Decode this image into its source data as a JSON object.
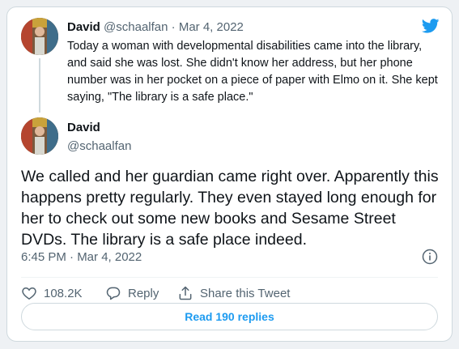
{
  "quoted_tweet": {
    "name": "David",
    "handle": "@schaalfan",
    "separator": "·",
    "date": "Mar 4, 2022",
    "text": "Today a woman with developmental disabilities came into the library, and said she was lost. She didn't know her address, but her phone number was in her pocket on a piece of paper with Elmo on it. She kept saying, \"The library is a safe place.\""
  },
  "main_tweet": {
    "name": "David",
    "handle": "@schaalfan",
    "text": "We called and her guardian came right over. Apparently this happens pretty regularly. They even stayed long enough for her to check out some new books and Sesame Street DVDs. The library is a safe place indeed.",
    "timestamp": "6:45 PM · Mar 4, 2022"
  },
  "actions": {
    "like_count": "108.2K",
    "reply_label": "Reply",
    "share_label": "Share this Tweet"
  },
  "read_replies_label": "Read 190 replies",
  "icons": {
    "brand": "twitter-bird-icon",
    "info": "info-icon",
    "like": "heart-icon",
    "reply": "reply-icon",
    "share": "share-icon"
  },
  "colors": {
    "brand_blue": "#1d9bf0",
    "text_primary": "#0f1419",
    "text_secondary": "#536471",
    "border": "#cfd9de"
  }
}
